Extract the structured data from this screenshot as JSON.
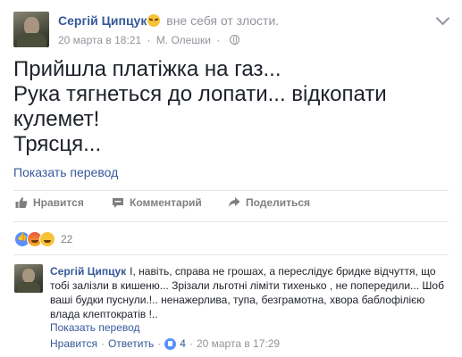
{
  "post": {
    "author": "Сергій Ципцук",
    "feeling": "вне себя от злости.",
    "date": "20 марта в 18:21",
    "location": "М. Олешки",
    "separator": "·",
    "body_lines": [
      "Прийшла платіжка на газ...",
      "Рука тягнеться до лопати... відкопати кулемет!",
      "Трясця..."
    ],
    "translate_label": "Показать перевод"
  },
  "actions": {
    "like": "Нравится",
    "comment": "Комментарий",
    "share": "Поделиться"
  },
  "reactions": {
    "count": "22"
  },
  "comment": {
    "author": "Сергій Ципцук",
    "text": "І, навіть, справа не грошах, а переслідує бридке відчуття, що тобі залізли в кишеню... Зрізали льготні ліміти тихенько , не попередили... Шоб ваші будки пуснули.!.. ненажерлива, тупа, безграмотна, хвора баблофілією влада клептократів !..",
    "translate_label": "Показать перевод",
    "like_label": "Нравится",
    "reply_label": "Ответить",
    "like_count": "4",
    "date": "20 марта в 17:29",
    "separator": "·"
  }
}
